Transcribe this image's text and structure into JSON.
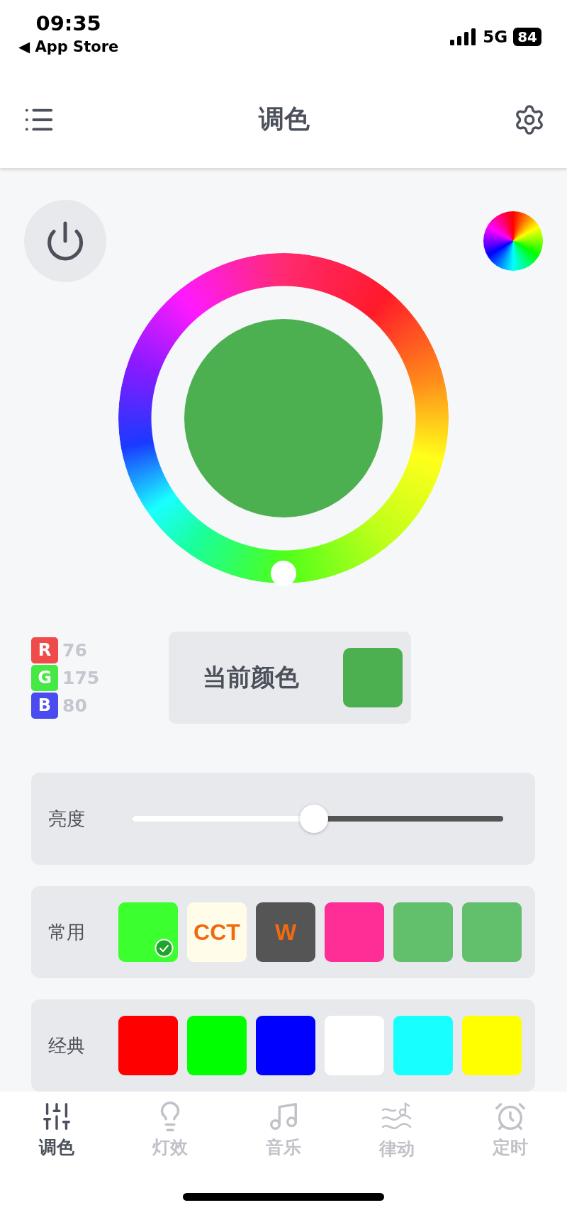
{
  "status_bar": {
    "time": "09:35",
    "back_label": "◀ App Store",
    "network": "5G",
    "battery": "84"
  },
  "header": {
    "title": "调色"
  },
  "current_color": {
    "label": "当前颜色",
    "color": "#4caf50"
  },
  "rgb": [
    {
      "letter": "R",
      "value": "76",
      "color": "#f04b4b"
    },
    {
      "letter": "G",
      "value": "175",
      "color": "#45e845"
    },
    {
      "letter": "B",
      "value": "80",
      "color": "#4b4bf0"
    }
  ],
  "brightness": {
    "label": "亮度",
    "level": 0.49
  },
  "common": {
    "label": "常用",
    "chips": [
      {
        "kind": "color",
        "color": "#3cff2f",
        "selected": true
      },
      {
        "kind": "cct",
        "label": "CCT",
        "color": "#fffde9",
        "selected": false
      },
      {
        "kind": "w",
        "label": "W",
        "color": "#555555",
        "selected": false
      },
      {
        "kind": "color",
        "color": "#ff2d96",
        "selected": false
      },
      {
        "kind": "color",
        "color": "#62c06c",
        "selected": false
      },
      {
        "kind": "color",
        "color": "#62c06c",
        "selected": false
      }
    ]
  },
  "classic": {
    "label": "经典",
    "chips": [
      {
        "kind": "color",
        "color": "#ff0000",
        "selected": false
      },
      {
        "kind": "color",
        "color": "#00ff00",
        "selected": false
      },
      {
        "kind": "color",
        "color": "#0000ff",
        "selected": false
      },
      {
        "kind": "color",
        "color": "#ffffff",
        "selected": false
      },
      {
        "kind": "color",
        "color": "#17ffff",
        "selected": false
      },
      {
        "kind": "color",
        "color": "#ffff00",
        "selected": false
      }
    ]
  },
  "tabs": [
    {
      "label": "调色",
      "kind": "sliders",
      "selected": true
    },
    {
      "label": "灯效",
      "kind": "bulb",
      "selected": false
    },
    {
      "label": "音乐",
      "kind": "music",
      "selected": false
    },
    {
      "label": "律动",
      "kind": "rhythm",
      "selected": false
    },
    {
      "label": "定时",
      "kind": "alarm",
      "selected": false
    }
  ]
}
